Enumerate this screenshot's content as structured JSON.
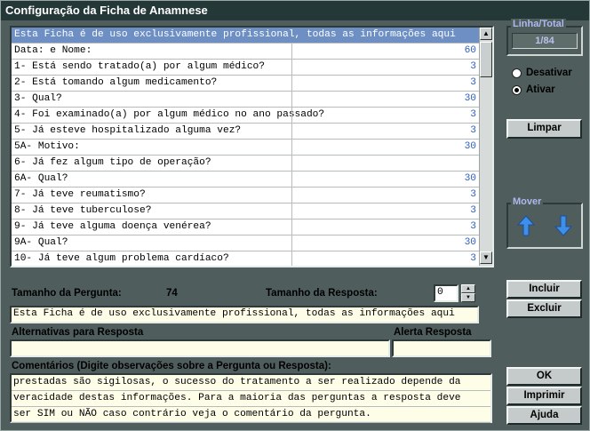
{
  "window": {
    "title": "Configuração da Ficha de Anamnese"
  },
  "questions": [
    {
      "text": "Esta Ficha é de uso exclusivamente profissional, todas as informações aqui",
      "size": "",
      "selected": true
    },
    {
      "text": "Data: e Nome:",
      "size": "60",
      "selected": false
    },
    {
      "text": "1- Está sendo tratado(a) por algum médico?",
      "size": "3",
      "selected": false
    },
    {
      "text": "2- Está tomando algum medicamento?",
      "size": "3",
      "selected": false
    },
    {
      "text": "3- Qual?",
      "size": "30",
      "selected": false
    },
    {
      "text": "4- Foi examinado(a) por algum médico no ano passado?",
      "size": "3",
      "selected": false
    },
    {
      "text": "5- Já esteve hospitalizado alguma vez?",
      "size": "3",
      "selected": false
    },
    {
      "text": "5A- Motivo:",
      "size": "30",
      "selected": false
    },
    {
      "text": "6- Já fez algum tipo de operação?",
      "size": "",
      "selected": false
    },
    {
      "text": "6A- Qual?",
      "size": "30",
      "selected": false
    },
    {
      "text": "7- Já teve reumatismo?",
      "size": "3",
      "selected": false
    },
    {
      "text": "8- Já teve tuberculose?",
      "size": "3",
      "selected": false
    },
    {
      "text": "9- Já teve alguma doença venérea?",
      "size": "3",
      "selected": false
    },
    {
      "text": "9A- Qual?",
      "size": "30",
      "selected": false
    },
    {
      "text": "10- Já teve algum problema cardíaco?",
      "size": "3",
      "selected": false
    }
  ],
  "linha_total": {
    "title": "Linha/Total",
    "value": "1/84"
  },
  "radios": {
    "desativar": "Desativar",
    "ativar": "Ativar",
    "selected": "ativar"
  },
  "buttons": {
    "limpar": "Limpar",
    "incluir": "Incluir",
    "excluir": "Excluir",
    "ok": "OK",
    "imprimir": "Imprimir",
    "ajuda": "Ajuda"
  },
  "mover": {
    "title": "Mover"
  },
  "form": {
    "tamanho_pergunta_label": "Tamanho da Pergunta:",
    "tamanho_pergunta_value": "74",
    "tamanho_resposta_label": "Tamanho da Resposta:",
    "tamanho_resposta_value": "0",
    "pergunta_text": "Esta Ficha é de uso exclusivamente profissional, todas as informações aqui",
    "alternativas_label": "Alternativas para Resposta",
    "alternativas_value": "",
    "alerta_label": "Alerta Resposta",
    "alerta_value": "",
    "comentarios_label": "Comentários (Digite observações sobre a Pergunta ou Resposta):",
    "comentarios_lines": [
      "prestadas são sigilosas, o sucesso do tratamento a ser realizado depende da",
      "veracidade destas informações. Para a maioria das perguntas a resposta deve",
      "ser SIM ou NÃO caso contrário veja o comentário da pergunta."
    ]
  },
  "colors": {
    "selection": "#6e8fc4",
    "field_bg": "#fdfde8",
    "title_bg": "#253838",
    "arrow": "#3f8fe8"
  }
}
